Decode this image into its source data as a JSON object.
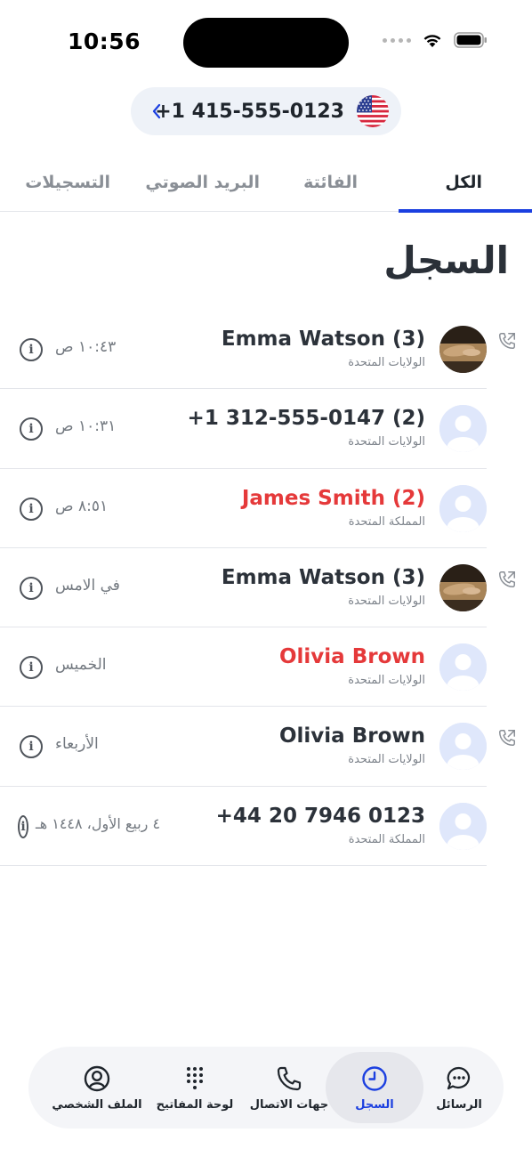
{
  "status": {
    "time": "10:56"
  },
  "header": {
    "phone_number": "+1 415-555-0123",
    "flag": "us-flag"
  },
  "tabs": [
    {
      "label": "الكل",
      "active": true
    },
    {
      "label": "الفائتة",
      "active": false
    },
    {
      "label": "البريد الصوتي",
      "active": false
    },
    {
      "label": "التسجيلات",
      "active": false
    }
  ],
  "title": "السجل",
  "calls": [
    {
      "name": "Emma Watson (3)",
      "country": "الولايات المتحدة",
      "time": "١٠:٤٣ ص",
      "missed": false,
      "photo": true,
      "outgoing": true
    },
    {
      "name": "+1 312-555-0147 (2)",
      "country": "الولايات المتحدة",
      "time": "١٠:٣١ ص",
      "missed": false,
      "photo": false,
      "outgoing": false
    },
    {
      "name": "James Smith (2)",
      "country": "المملكة المتحدة",
      "time": "٨:٥١ ص",
      "missed": true,
      "photo": false,
      "outgoing": false
    },
    {
      "name": "Emma Watson (3)",
      "country": "الولايات المتحدة",
      "time": "في الامس",
      "missed": false,
      "photo": true,
      "outgoing": true
    },
    {
      "name": "Olivia Brown",
      "country": "الولايات المتحدة",
      "time": "الخميس",
      "missed": true,
      "photo": false,
      "outgoing": false
    },
    {
      "name": "Olivia Brown",
      "country": "الولايات المتحدة",
      "time": "الأربعاء",
      "missed": false,
      "photo": false,
      "outgoing": true
    },
    {
      "name": "+44 20 7946 0123",
      "country": "المملكة المتحدة",
      "time": "٤ ربيع الأول، ١٤٤٨ هـ",
      "missed": false,
      "photo": false,
      "outgoing": false
    }
  ],
  "nav": [
    {
      "label": "الرسائل",
      "icon": "chat-bubble-icon",
      "active": false
    },
    {
      "label": "السجل",
      "icon": "clock-icon",
      "active": true
    },
    {
      "label": "جهات الاتصال",
      "icon": "phone-icon",
      "active": false
    },
    {
      "label": "لوحة المفاتيح",
      "icon": "keypad-icon",
      "active": false
    },
    {
      "label": "الملف الشخصي",
      "icon": "profile-icon",
      "active": false
    }
  ],
  "colors": {
    "accent": "#1b3fe0",
    "missed": "#e5393a",
    "text": "#2c323a",
    "muted": "#7d838b"
  }
}
